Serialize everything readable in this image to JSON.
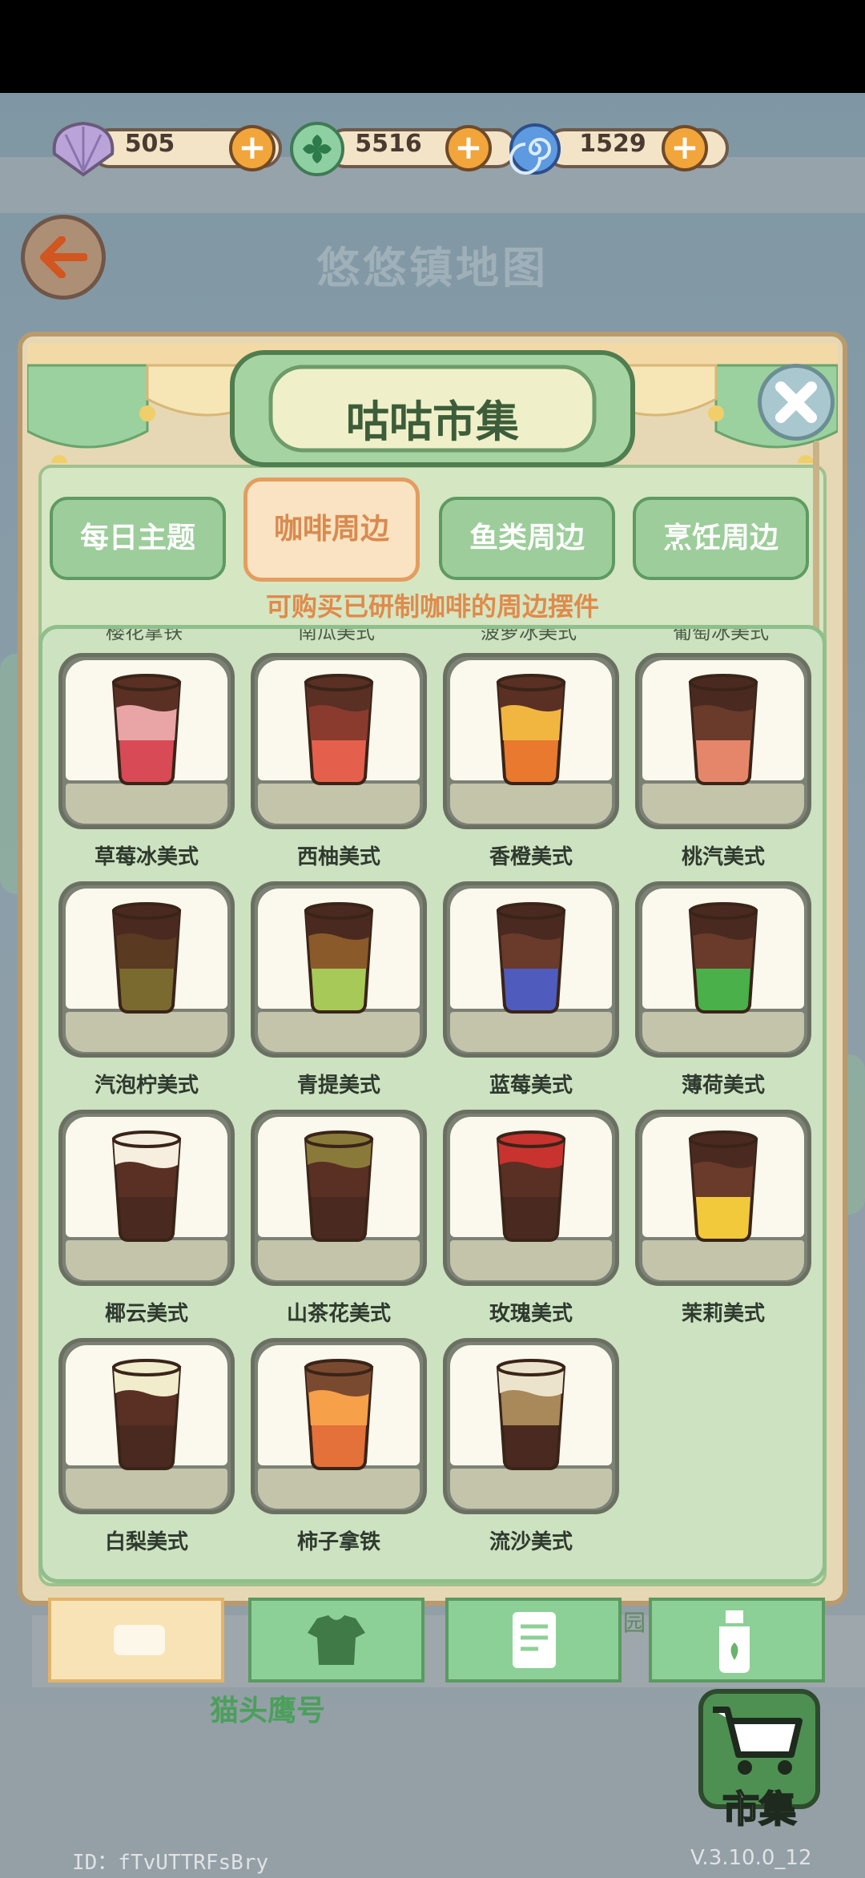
{
  "currencies": [
    {
      "icon": "shell-icon",
      "amount": "505"
    },
    {
      "icon": "clover-coin-icon",
      "amount": "5516"
    },
    {
      "icon": "swirl-gem-icon",
      "amount": "1529"
    }
  ],
  "header": {
    "title": "悠悠镇地图"
  },
  "dialog": {
    "title": "咕咕市集",
    "tabs": [
      "每日主题",
      "咖啡周边",
      "鱼类周边",
      "烹饪周边"
    ],
    "active_tab": 1,
    "subtitle": "可购买已研制咖啡的周边摆件",
    "cut_labels": [
      "樱花拿铁",
      "南瓜美式",
      "菠萝冰美式",
      "葡萄冰美式"
    ],
    "items": [
      {
        "name": "草莓冰美式",
        "colors": [
          "#5a2f24",
          "#e9a4a6",
          "#d84a55"
        ]
      },
      {
        "name": "西柚美式",
        "colors": [
          "#5a2f24",
          "#8a3b2e",
          "#e4604d"
        ]
      },
      {
        "name": "香橙美式",
        "colors": [
          "#5a2f24",
          "#f0b640",
          "#e8792e"
        ]
      },
      {
        "name": "桃汽美式",
        "colors": [
          "#4a2a20",
          "#6a3a2a",
          "#e5866b"
        ]
      },
      {
        "name": "汽泡柠美式",
        "colors": [
          "#4a2a20",
          "#5a3a20",
          "#7a6a30"
        ]
      },
      {
        "name": "青提美式",
        "colors": [
          "#4a2a20",
          "#8a5a2a",
          "#a7c957"
        ]
      },
      {
        "name": "蓝莓美式",
        "colors": [
          "#4a2a20",
          "#6a3a2a",
          "#4f5bbd"
        ]
      },
      {
        "name": "薄荷美式",
        "colors": [
          "#4a2a20",
          "#6a3a2a",
          "#4ab04a"
        ]
      },
      {
        "name": "椰云美式",
        "colors": [
          "#f6efe0",
          "#5a2f24",
          "#4a2a20"
        ]
      },
      {
        "name": "山茶花美式",
        "colors": [
          "#8a7a3a",
          "#5a2f24",
          "#4a2a20"
        ]
      },
      {
        "name": "玫瑰美式",
        "colors": [
          "#c8322f",
          "#5a2f24",
          "#4a2a20"
        ]
      },
      {
        "name": "茉莉美式",
        "colors": [
          "#4a2a20",
          "#6a3a2a",
          "#f1c93a"
        ]
      },
      {
        "name": "白梨美式",
        "colors": [
          "#f1eccc",
          "#5a2f24",
          "#4a2a20"
        ]
      },
      {
        "name": "柿子拿铁",
        "colors": [
          "#7a4a30",
          "#f6a04a",
          "#e4703a"
        ]
      },
      {
        "name": "流沙美式",
        "colors": [
          "#ece3cc",
          "#a9885a",
          "#4a2a20"
        ]
      }
    ]
  },
  "bottom_nav": [
    {
      "icon": "sofa-icon"
    },
    {
      "icon": "shirt-icon"
    },
    {
      "icon": "notepad-icon"
    },
    {
      "icon": "bottle-icon"
    }
  ],
  "owl_label": "猫头鹰号",
  "yuan_label": "园",
  "market": {
    "label": "市集",
    "icon": "cart-icon"
  },
  "footer": {
    "uid": "ID：fTvUTTRFsBry",
    "version": "V.3.10.0_12"
  }
}
